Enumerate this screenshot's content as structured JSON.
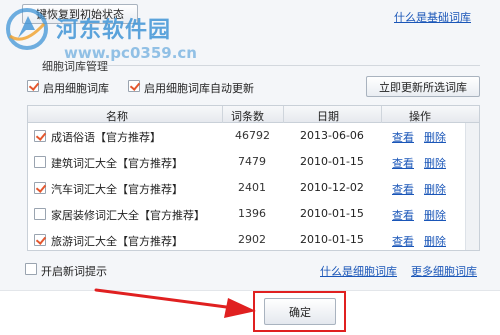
{
  "top": {
    "reset_button_label": "键恢复到初始状态",
    "basic_dict_link": "什么是基础词库"
  },
  "watermark": {
    "title": "河东软件园",
    "url": "www.pc0359.cn"
  },
  "cell_dict": {
    "group_title": "细胞词库管理",
    "enable_label": "启用细胞词库",
    "enable_checked": true,
    "auto_update_label": "启用细胞词库自动更新",
    "auto_update_checked": true,
    "update_now_label": "立即更新所选词库"
  },
  "table": {
    "columns": [
      "名称",
      "词条数",
      "日期",
      "操作"
    ],
    "action_view": "查看",
    "action_delete": "删除",
    "rows": [
      {
        "name": "成语俗语【官方推荐】",
        "count": "46792",
        "date": "2013-06-06",
        "checked": true
      },
      {
        "name": "建筑词汇大全【官方推荐】",
        "count": "7479",
        "date": "2010-01-15",
        "checked": false
      },
      {
        "name": "汽车词汇大全【官方推荐】",
        "count": "2401",
        "date": "2010-12-02",
        "checked": true
      },
      {
        "name": "家居装修词汇大全【官方推荐】",
        "count": "1396",
        "date": "2010-01-15",
        "checked": false
      },
      {
        "name": "旅游词汇大全【官方推荐】",
        "count": "2902",
        "date": "2010-01-15",
        "checked": true
      }
    ]
  },
  "footer_options": {
    "new_word_hint_label": "开启新词提示",
    "new_word_hint_checked": false,
    "what_is_cell_link": "什么是细胞词库",
    "more_cell_link": "更多细胞词库"
  },
  "confirm_label": "确定",
  "colors": {
    "checkmark": "#e4572e",
    "link": "#1a56b8",
    "highlight": "#e02020",
    "watermark": "#4094d6"
  }
}
